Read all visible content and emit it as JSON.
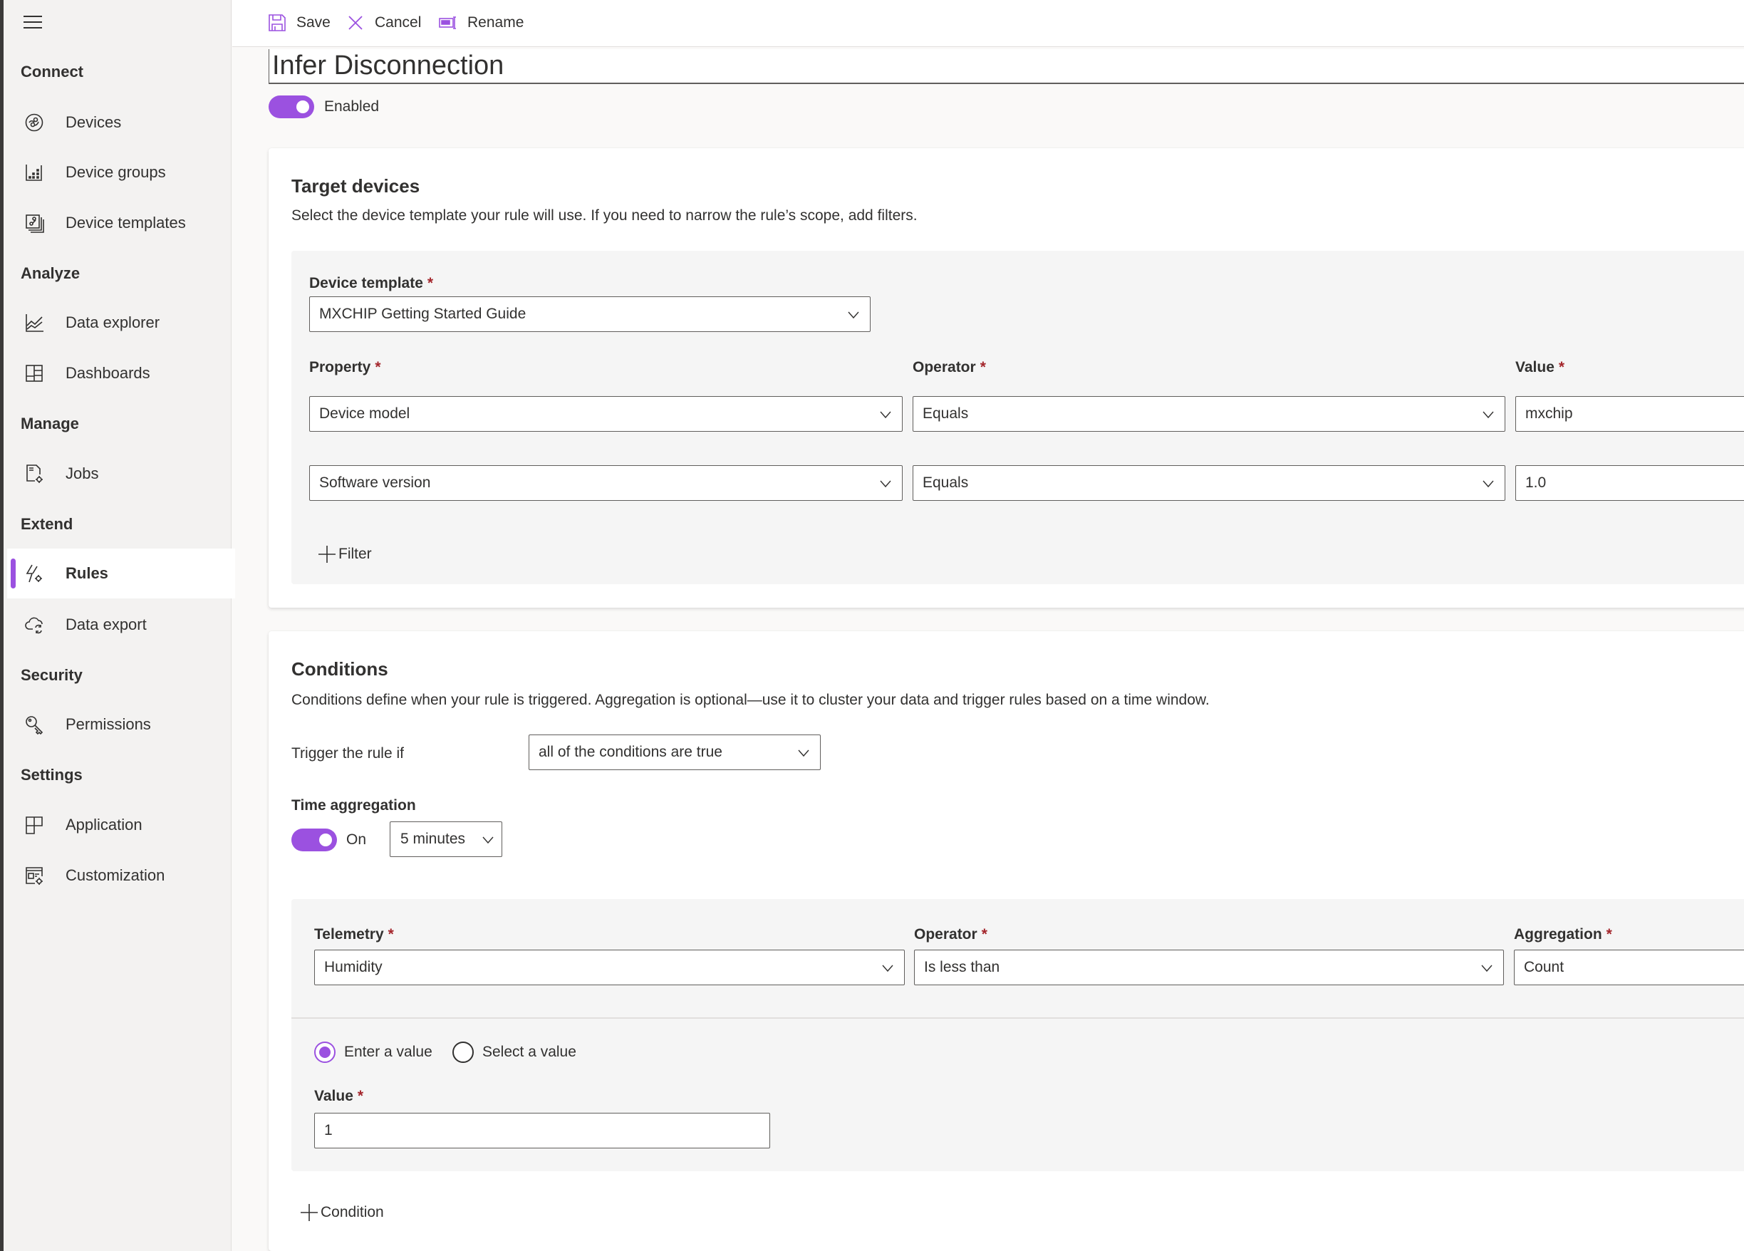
{
  "sidebar": {
    "menu_icon": "hamburger-icon",
    "sections": [
      {
        "label": "Connect",
        "items": [
          {
            "label": "Devices",
            "icon": "devices-icon"
          },
          {
            "label": "Device groups",
            "icon": "device-groups-icon"
          },
          {
            "label": "Device templates",
            "icon": "device-templates-icon"
          }
        ]
      },
      {
        "label": "Analyze",
        "items": [
          {
            "label": "Data explorer",
            "icon": "line-chart-icon"
          },
          {
            "label": "Dashboards",
            "icon": "dashboard-icon"
          }
        ]
      },
      {
        "label": "Manage",
        "items": [
          {
            "label": "Jobs",
            "icon": "jobs-icon"
          }
        ]
      },
      {
        "label": "Extend",
        "items": [
          {
            "label": "Rules",
            "icon": "rules-icon",
            "active": true
          },
          {
            "label": "Data export",
            "icon": "data-export-icon"
          }
        ]
      },
      {
        "label": "Security",
        "items": [
          {
            "label": "Permissions",
            "icon": "key-icon"
          }
        ]
      },
      {
        "label": "Settings",
        "items": [
          {
            "label": "Application",
            "icon": "application-icon"
          },
          {
            "label": "Customization",
            "icon": "customization-icon"
          }
        ]
      }
    ]
  },
  "toolbar": {
    "save_label": "Save",
    "cancel_label": "Cancel",
    "rename_label": "Rename"
  },
  "rule": {
    "name": "Infer Disconnection",
    "enabled_label": "Enabled",
    "enabled": true
  },
  "target_devices": {
    "title": "Target devices",
    "description": "Select the device template your rule will use. If you need to narrow the rule’s scope, add filters.",
    "device_template_label": "Device template",
    "device_template_value": "MXCHIP Getting Started Guide",
    "required_mark": "*",
    "columns": {
      "property": "Property",
      "operator": "Operator",
      "value": "Value"
    },
    "filters": [
      {
        "property": "Device model",
        "operator": "Equals",
        "value": "mxchip"
      },
      {
        "property": "Software version",
        "operator": "Equals",
        "value": "1.0"
      }
    ],
    "add_filter_label": "Filter"
  },
  "conditions": {
    "title": "Conditions",
    "description": "Conditions define when your rule is triggered. Aggregation is optional—use it to cluster your data and trigger rules based on a time window.",
    "trigger_label": "Trigger the rule if",
    "trigger_value": "all of the conditions are true",
    "time_aggregation_label": "Time aggregation",
    "time_aggregation_state": "On",
    "time_aggregation_on": true,
    "time_window": "5 minutes",
    "condition": {
      "telemetry_label": "Telemetry",
      "telemetry_value": "Humidity",
      "operator_label": "Operator",
      "operator_value": "Is less than",
      "aggregation_label": "Aggregation",
      "aggregation_value": "Count",
      "radio_enter": "Enter a value",
      "radio_select": "Select a value",
      "selected_radio": "Enter a value",
      "value_label": "Value",
      "value": "1"
    },
    "add_condition_label": "Condition"
  },
  "colors": {
    "accent": "#9b51e0",
    "required": "#a4262c",
    "sidebar_bg": "#f3f2f1",
    "panel_bg": "#f5f5f5"
  }
}
